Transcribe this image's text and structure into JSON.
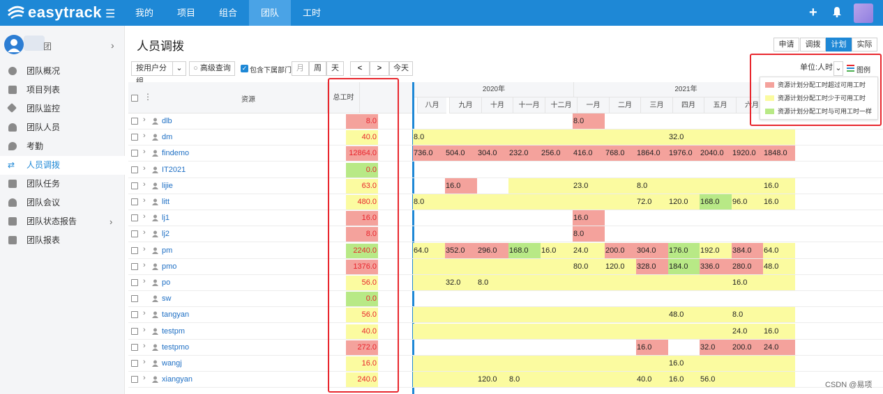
{
  "app": {
    "logo_text": "easytrack"
  },
  "topnav": [
    {
      "label": "我的"
    },
    {
      "label": "项目"
    },
    {
      "label": "组合"
    },
    {
      "label": "团队"
    },
    {
      "label": "工时"
    }
  ],
  "sidebar": {
    "team_name": "团",
    "items": [
      {
        "label": "团队概况"
      },
      {
        "label": "项目列表"
      },
      {
        "label": "团队监控"
      },
      {
        "label": "团队人员"
      },
      {
        "label": "考勤"
      },
      {
        "label": "人员调拨"
      },
      {
        "label": "团队任务"
      },
      {
        "label": "团队会议"
      },
      {
        "label": "团队状态报告"
      },
      {
        "label": "团队报表"
      }
    ]
  },
  "page": {
    "title": "人员调拨"
  },
  "view_tabs": [
    "申请",
    "调拨",
    "计划",
    "实际"
  ],
  "toolbar": {
    "group_select": "按用户分组",
    "advanced_search": "高级查询",
    "include_sub": "包含下属部门",
    "scale_month": "月",
    "scale_week": "周",
    "scale_day": "天",
    "prev": "<",
    "next": ">",
    "today": "今天",
    "unit_select": "单位:人时",
    "legend_btn": "图例"
  },
  "legend": [
    {
      "label": "资源计划分配工时超过可用工时",
      "color": "#f4a29c"
    },
    {
      "label": "资源计划分配工时少于可用工时",
      "color": "#fbfba0"
    },
    {
      "label": "资源计划分配工时与可用工时一样",
      "color": "#b8e986"
    }
  ],
  "grid": {
    "resource_header": "资源",
    "total_header": "总工时",
    "years": [
      "2020年",
      "2021年"
    ],
    "months": [
      "八月",
      "九月",
      "十月",
      "十一月",
      "十二月",
      "一月",
      "二月",
      "三月",
      "四月",
      "五月",
      "六月"
    ],
    "rows": [
      {
        "name": "dlb",
        "total": "8.0",
        "status": "over",
        "cells": [
          [
            "",
            ""
          ],
          [
            "",
            ""
          ],
          [
            "",
            ""
          ],
          [
            "",
            ""
          ],
          [
            "",
            ""
          ],
          [
            "8.0",
            "over"
          ],
          [
            "",
            ""
          ],
          [
            "",
            ""
          ],
          [
            "",
            ""
          ],
          [
            "",
            ""
          ],
          [
            "",
            ""
          ],
          [
            "",
            ""
          ]
        ]
      },
      {
        "name": "dm",
        "total": "40.0",
        "status": "under",
        "cells": [
          [
            "8.0",
            "under"
          ],
          [
            "",
            "under"
          ],
          [
            "",
            "under"
          ],
          [
            "",
            "under"
          ],
          [
            "",
            "under"
          ],
          [
            "",
            "under"
          ],
          [
            "",
            "under"
          ],
          [
            "",
            "under"
          ],
          [
            "32.0",
            "under"
          ],
          [
            "",
            "under"
          ],
          [
            "",
            "under"
          ],
          [
            "",
            "under"
          ]
        ]
      },
      {
        "name": "findemo",
        "total": "12864.0",
        "status": "over",
        "cells": [
          [
            "736.0",
            "over"
          ],
          [
            "504.0",
            "over"
          ],
          [
            "304.0",
            "over"
          ],
          [
            "232.0",
            "over"
          ],
          [
            "256.0",
            "over"
          ],
          [
            "416.0",
            "over"
          ],
          [
            "768.0",
            "over"
          ],
          [
            "1864.0",
            "over"
          ],
          [
            "1976.0",
            "over"
          ],
          [
            "2040.0",
            "over"
          ],
          [
            "1920.0",
            "over"
          ],
          [
            "1848.0",
            "over"
          ]
        ]
      },
      {
        "name": "IT2021",
        "total": "0.0",
        "status": "equal",
        "cells": [
          [
            "",
            ""
          ],
          [
            "",
            ""
          ],
          [
            "",
            ""
          ],
          [
            "",
            ""
          ],
          [
            "",
            ""
          ],
          [
            "",
            ""
          ],
          [
            "",
            ""
          ],
          [
            "",
            ""
          ],
          [
            "",
            ""
          ],
          [
            "",
            ""
          ],
          [
            "",
            ""
          ],
          [
            "",
            ""
          ]
        ]
      },
      {
        "name": "lijie",
        "total": "63.0",
        "status": "under",
        "cells": [
          [
            "",
            ""
          ],
          [
            "16.0",
            "over"
          ],
          [
            "",
            ""
          ],
          [
            "",
            "under"
          ],
          [
            "",
            "under"
          ],
          [
            "23.0",
            "under"
          ],
          [
            "",
            "under"
          ],
          [
            "8.0",
            "under"
          ],
          [
            "",
            "under"
          ],
          [
            "",
            "under"
          ],
          [
            "",
            "under"
          ],
          [
            "16.0",
            "under"
          ]
        ]
      },
      {
        "name": "litt",
        "total": "480.0",
        "status": "under",
        "cells": [
          [
            "8.0",
            "under"
          ],
          [
            "",
            "under"
          ],
          [
            "",
            "under"
          ],
          [
            "",
            "under"
          ],
          [
            "",
            "under"
          ],
          [
            "",
            "under"
          ],
          [
            "",
            "under"
          ],
          [
            "72.0",
            "under"
          ],
          [
            "120.0",
            "under"
          ],
          [
            "168.0",
            "equal"
          ],
          [
            "96.0",
            "under"
          ],
          [
            "16.0",
            "under"
          ]
        ]
      },
      {
        "name": "lj1",
        "total": "16.0",
        "status": "over",
        "cells": [
          [
            "",
            ""
          ],
          [
            "",
            ""
          ],
          [
            "",
            ""
          ],
          [
            "",
            ""
          ],
          [
            "",
            ""
          ],
          [
            "16.0",
            "over"
          ],
          [
            "",
            ""
          ],
          [
            "",
            ""
          ],
          [
            "",
            ""
          ],
          [
            "",
            ""
          ],
          [
            "",
            ""
          ],
          [
            "",
            ""
          ]
        ]
      },
      {
        "name": "lj2",
        "total": "8.0",
        "status": "over",
        "cells": [
          [
            "",
            ""
          ],
          [
            "",
            ""
          ],
          [
            "",
            ""
          ],
          [
            "",
            ""
          ],
          [
            "",
            ""
          ],
          [
            "8.0",
            "over"
          ],
          [
            "",
            ""
          ],
          [
            "",
            ""
          ],
          [
            "",
            ""
          ],
          [
            "",
            ""
          ],
          [
            "",
            ""
          ],
          [
            "",
            ""
          ]
        ]
      },
      {
        "name": "pm",
        "total": "2240.0",
        "status": "equal",
        "cells": [
          [
            "64.0",
            "under"
          ],
          [
            "352.0",
            "over"
          ],
          [
            "296.0",
            "over"
          ],
          [
            "168.0",
            "equal"
          ],
          [
            "16.0",
            "under"
          ],
          [
            "24.0",
            "under"
          ],
          [
            "200.0",
            "over"
          ],
          [
            "304.0",
            "over"
          ],
          [
            "176.0",
            "equal"
          ],
          [
            "192.0",
            "under"
          ],
          [
            "384.0",
            "over"
          ],
          [
            "64.0",
            "under"
          ]
        ]
      },
      {
        "name": "pmo",
        "total": "1376.0",
        "status": "over",
        "cells": [
          [
            "",
            "under"
          ],
          [
            "",
            "under"
          ],
          [
            "",
            "under"
          ],
          [
            "",
            "under"
          ],
          [
            "",
            "under"
          ],
          [
            "80.0",
            "under"
          ],
          [
            "120.0",
            "under"
          ],
          [
            "328.0",
            "over"
          ],
          [
            "184.0",
            "equal"
          ],
          [
            "336.0",
            "over"
          ],
          [
            "280.0",
            "over"
          ],
          [
            "48.0",
            "under"
          ]
        ]
      },
      {
        "name": "po",
        "total": "56.0",
        "status": "under",
        "cells": [
          [
            "",
            "under"
          ],
          [
            "32.0",
            "under"
          ],
          [
            "8.0",
            "under"
          ],
          [
            "",
            "under"
          ],
          [
            "",
            "under"
          ],
          [
            "",
            "under"
          ],
          [
            "",
            "under"
          ],
          [
            "",
            "under"
          ],
          [
            "",
            "under"
          ],
          [
            "",
            "under"
          ],
          [
            "16.0",
            "under"
          ],
          [
            "",
            "under"
          ]
        ]
      },
      {
        "name": "sw",
        "total": "0.0",
        "status": "equal",
        "cells": [
          [
            "",
            ""
          ],
          [
            "",
            ""
          ],
          [
            "",
            ""
          ],
          [
            "",
            ""
          ],
          [
            "",
            ""
          ],
          [
            "",
            ""
          ],
          [
            "",
            ""
          ],
          [
            "",
            ""
          ],
          [
            "",
            ""
          ],
          [
            "",
            ""
          ],
          [
            "",
            ""
          ],
          [
            "",
            ""
          ]
        ]
      },
      {
        "name": "tangyan",
        "total": "56.0",
        "status": "under",
        "cells": [
          [
            "",
            "under"
          ],
          [
            "",
            "under"
          ],
          [
            "",
            "under"
          ],
          [
            "",
            "under"
          ],
          [
            "",
            "under"
          ],
          [
            "",
            "under"
          ],
          [
            "",
            "under"
          ],
          [
            "",
            "under"
          ],
          [
            "48.0",
            "under"
          ],
          [
            "",
            "under"
          ],
          [
            "8.0",
            "under"
          ],
          [
            "",
            "under"
          ]
        ]
      },
      {
        "name": "testpm",
        "total": "40.0",
        "status": "under",
        "cells": [
          [
            "",
            "under"
          ],
          [
            "",
            "under"
          ],
          [
            "",
            "under"
          ],
          [
            "",
            "under"
          ],
          [
            "",
            "under"
          ],
          [
            "",
            "under"
          ],
          [
            "",
            "under"
          ],
          [
            "",
            "under"
          ],
          [
            "",
            "under"
          ],
          [
            "",
            "under"
          ],
          [
            "24.0",
            "under"
          ],
          [
            "16.0",
            "under"
          ]
        ]
      },
      {
        "name": "testpmo",
        "total": "272.0",
        "status": "over",
        "cells": [
          [
            "",
            ""
          ],
          [
            "",
            ""
          ],
          [
            "",
            ""
          ],
          [
            "",
            ""
          ],
          [
            "",
            ""
          ],
          [
            "",
            ""
          ],
          [
            "",
            ""
          ],
          [
            "16.0",
            "over"
          ],
          [
            "",
            ""
          ],
          [
            "32.0",
            "over"
          ],
          [
            "200.0",
            "over"
          ],
          [
            "24.0",
            "over"
          ]
        ]
      },
      {
        "name": "wangj",
        "total": "16.0",
        "status": "under",
        "cells": [
          [
            "",
            "under"
          ],
          [
            "",
            "under"
          ],
          [
            "",
            "under"
          ],
          [
            "",
            "under"
          ],
          [
            "",
            "under"
          ],
          [
            "",
            "under"
          ],
          [
            "",
            "under"
          ],
          [
            "",
            "under"
          ],
          [
            "16.0",
            "under"
          ],
          [
            "",
            "under"
          ],
          [
            "",
            "under"
          ],
          [
            "",
            "under"
          ]
        ]
      },
      {
        "name": "xiangyan",
        "total": "240.0",
        "status": "under",
        "cells": [
          [
            "",
            "under"
          ],
          [
            "",
            "under"
          ],
          [
            "120.0",
            "under"
          ],
          [
            "8.0",
            "under"
          ],
          [
            "",
            "under"
          ],
          [
            "",
            "under"
          ],
          [
            "",
            "under"
          ],
          [
            "40.0",
            "under"
          ],
          [
            "16.0",
            "under"
          ],
          [
            "56.0",
            "under"
          ],
          [
            "",
            "under"
          ],
          [
            "",
            "under"
          ]
        ]
      }
    ]
  },
  "colors": {
    "over": "#f4a29c",
    "under": "#fbfba0",
    "equal": "#b8e986",
    "accent": "#1e88d6"
  },
  "watermark": "CSDN @易项"
}
